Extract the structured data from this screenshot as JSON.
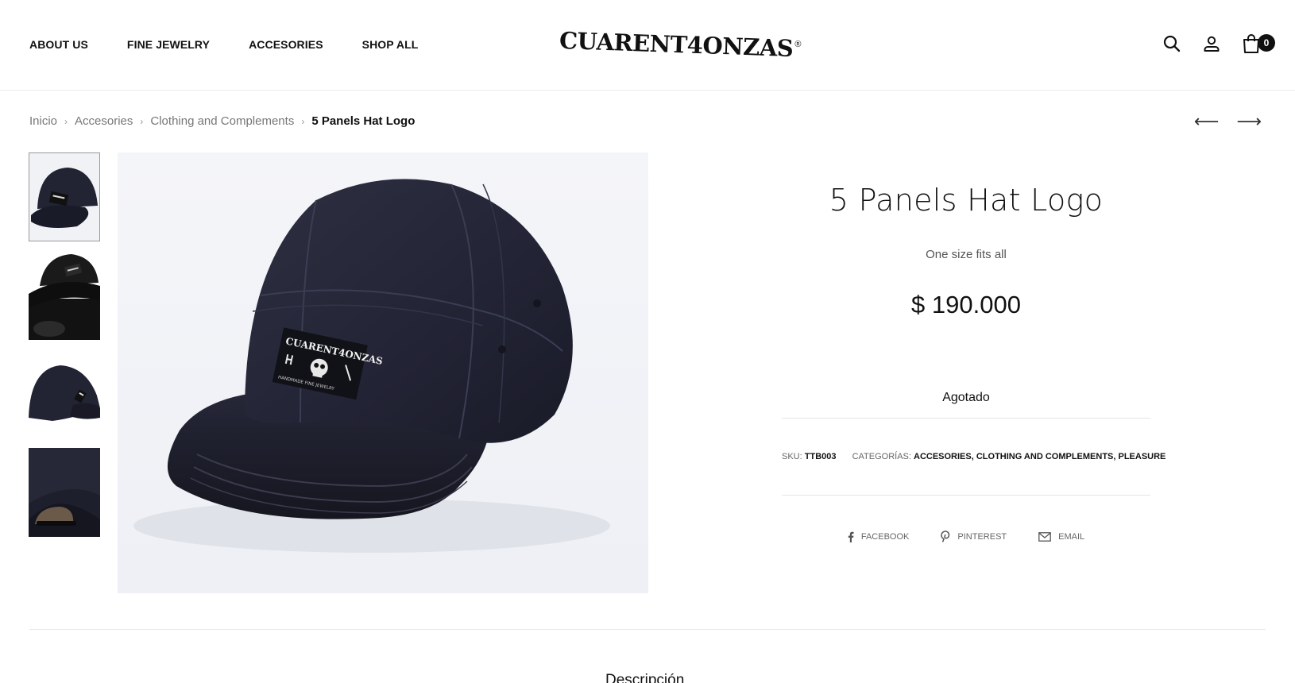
{
  "header": {
    "nav": [
      "ABOUT US",
      "FINE JEWELRY",
      "ACCESORIES",
      "SHOP ALL"
    ],
    "logo_text": "CUARENT4ONZAS",
    "logo_reg": "®",
    "cart_count": "0"
  },
  "breadcrumb": {
    "items": [
      "Inicio",
      "Accesories",
      "Clothing and Complements"
    ],
    "current": "5 Panels Hat Logo"
  },
  "product": {
    "title": "5 Panels Hat Logo",
    "subtitle": "One size fits all",
    "price": "$ 190.000",
    "stock_status": "Agotado",
    "sku_label": "SKU:",
    "sku": "TTB003",
    "categories_label": "CATEGORÍAS:",
    "categories": "ACCESORIES, CLOTHING AND COMPLEMENTS, PLEASURE",
    "patch_text": "CUARENT4ONZAS",
    "patch_subtext": "HANDMADE FINE JEWELRY"
  },
  "share": {
    "facebook": "FACEBOOK",
    "pinterest": "PINTEREST",
    "email": "EMAIL"
  },
  "tabs": {
    "description": "Descripción"
  },
  "colors": {
    "text": "#111111",
    "muted": "#777777",
    "hat": "#1f2030",
    "background": "#ffffff"
  },
  "icons": [
    "search-icon",
    "user-icon",
    "cart-icon",
    "arrow-left-icon",
    "arrow-right-icon",
    "facebook-icon",
    "pinterest-icon",
    "email-icon"
  ]
}
